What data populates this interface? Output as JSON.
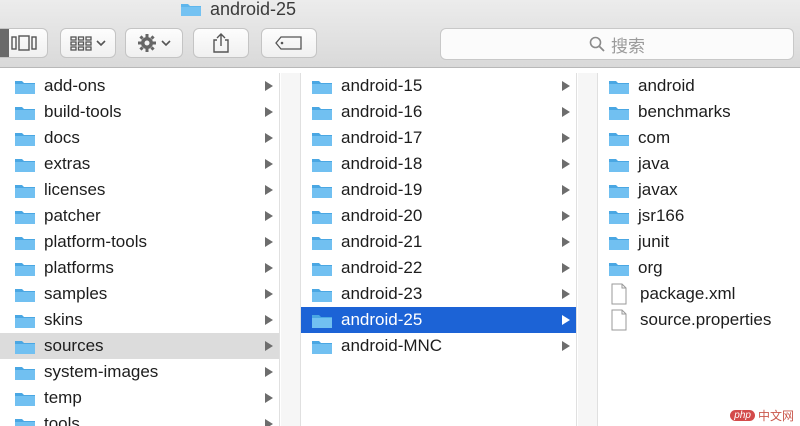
{
  "window": {
    "title": "android-25"
  },
  "toolbar": {
    "search_placeholder": "搜索"
  },
  "columns": {
    "col1": [
      {
        "label": "add-ons",
        "kind": "folder",
        "has_children": true
      },
      {
        "label": "build-tools",
        "kind": "folder",
        "has_children": true
      },
      {
        "label": "docs",
        "kind": "folder",
        "has_children": true
      },
      {
        "label": "extras",
        "kind": "folder",
        "has_children": true
      },
      {
        "label": "licenses",
        "kind": "folder",
        "has_children": true
      },
      {
        "label": "patcher",
        "kind": "folder",
        "has_children": true
      },
      {
        "label": "platform-tools",
        "kind": "folder",
        "has_children": true
      },
      {
        "label": "platforms",
        "kind": "folder",
        "has_children": true
      },
      {
        "label": "samples",
        "kind": "folder",
        "has_children": true
      },
      {
        "label": "skins",
        "kind": "folder",
        "has_children": true
      },
      {
        "label": "sources",
        "kind": "folder",
        "has_children": true,
        "selected": "path"
      },
      {
        "label": "system-images",
        "kind": "folder",
        "has_children": true
      },
      {
        "label": "temp",
        "kind": "folder",
        "has_children": true
      },
      {
        "label": "tools",
        "kind": "folder",
        "has_children": true
      }
    ],
    "col2": [
      {
        "label": "android-15",
        "kind": "folder",
        "has_children": true
      },
      {
        "label": "android-16",
        "kind": "folder",
        "has_children": true
      },
      {
        "label": "android-17",
        "kind": "folder",
        "has_children": true
      },
      {
        "label": "android-18",
        "kind": "folder",
        "has_children": true
      },
      {
        "label": "android-19",
        "kind": "folder",
        "has_children": true
      },
      {
        "label": "android-20",
        "kind": "folder",
        "has_children": true
      },
      {
        "label": "android-21",
        "kind": "folder",
        "has_children": true
      },
      {
        "label": "android-22",
        "kind": "folder",
        "has_children": true
      },
      {
        "label": "android-23",
        "kind": "folder",
        "has_children": true
      },
      {
        "label": "android-25",
        "kind": "folder",
        "has_children": true,
        "selected": "active"
      },
      {
        "label": "android-MNC",
        "kind": "folder",
        "has_children": true
      }
    ],
    "col3": [
      {
        "label": "android",
        "kind": "folder",
        "has_children": false
      },
      {
        "label": "benchmarks",
        "kind": "folder",
        "has_children": false
      },
      {
        "label": "com",
        "kind": "folder",
        "has_children": false
      },
      {
        "label": "java",
        "kind": "folder",
        "has_children": false
      },
      {
        "label": "javax",
        "kind": "folder",
        "has_children": false
      },
      {
        "label": "jsr166",
        "kind": "folder",
        "has_children": false
      },
      {
        "label": "junit",
        "kind": "folder",
        "has_children": false
      },
      {
        "label": "org",
        "kind": "folder",
        "has_children": false
      },
      {
        "label": "package.xml",
        "kind": "file",
        "has_children": false
      },
      {
        "label": "source.properties",
        "kind": "file",
        "has_children": false
      }
    ]
  },
  "watermark": {
    "badge": "php",
    "text": "中文网"
  },
  "colors": {
    "folder": "#5fb6ec",
    "selection_active": "#1c63d6",
    "selection_path": "#dcdcdc"
  }
}
